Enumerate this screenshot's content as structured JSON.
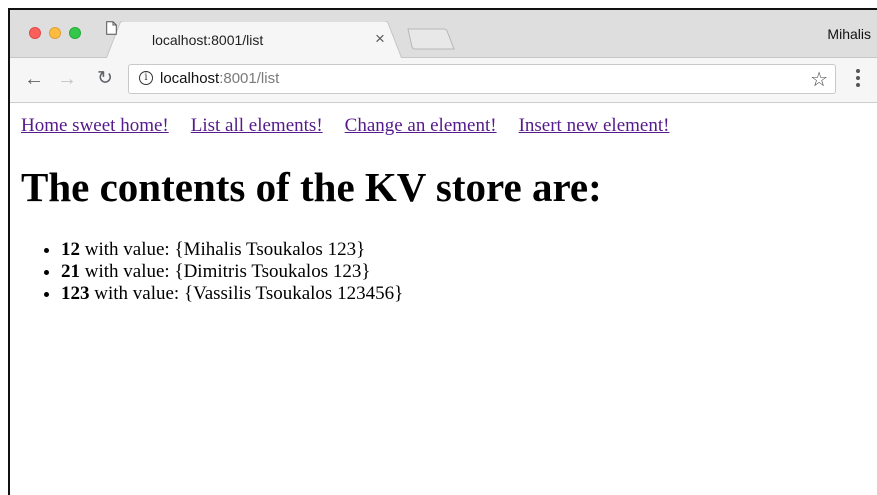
{
  "browser": {
    "tab": {
      "title": "localhost:8001/list",
      "close_glyph": "×"
    },
    "profile_name": "Mihalis",
    "address": {
      "host": "localhost",
      "rest": ":8001/list"
    },
    "colors": {
      "close": "#fc605b",
      "minimize": "#fdbc40",
      "zoom": "#34c84a"
    }
  },
  "nav": {
    "links": [
      {
        "label": "Home sweet home!"
      },
      {
        "label": "List all elements!"
      },
      {
        "label": "Change an element!"
      },
      {
        "label": "Insert new element!"
      }
    ]
  },
  "page": {
    "heading": "The contents of the KV store are:",
    "items": [
      {
        "key": "12",
        "text": " with value: {Mihalis Tsoukalos 123}"
      },
      {
        "key": "21",
        "text": " with value: {Dimitris Tsoukalos 123}"
      },
      {
        "key": "123",
        "text": " with value: {Vassilis Tsoukalos 123456}"
      }
    ]
  },
  "icons": {
    "back": "back-arrow-icon",
    "forward": "forward-arrow-icon",
    "reload": "reload-icon",
    "info": "info-icon",
    "bookmark": "star-icon",
    "menu": "more-vert-icon",
    "favicon": "page-icon"
  }
}
